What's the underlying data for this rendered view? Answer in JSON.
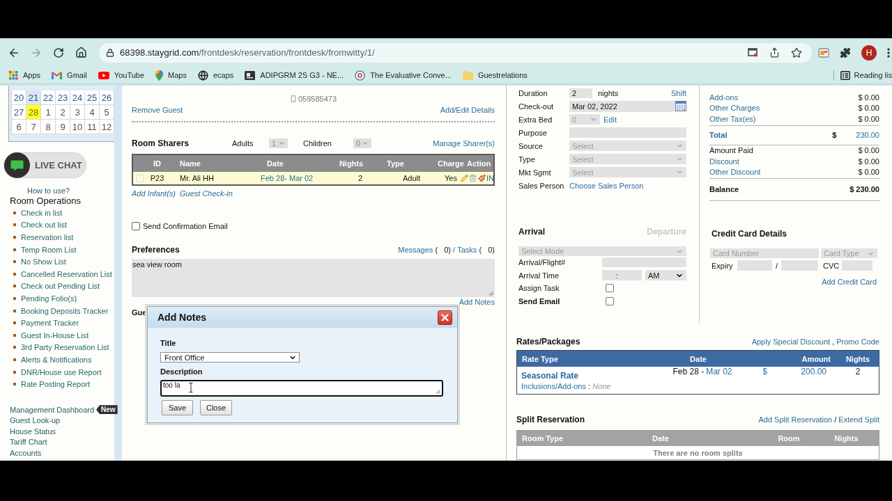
{
  "browser": {
    "url": {
      "domain": "68398.staygrid.com",
      "path": "/frontdesk/reservation/frontdesk/fromwitty/1/"
    },
    "profile_initial": "H",
    "bookmarks": [
      {
        "kind": "apps",
        "label": "Apps"
      },
      {
        "kind": "gmail",
        "label": "Gmail"
      },
      {
        "kind": "youtube",
        "label": "YouTube"
      },
      {
        "kind": "maps",
        "label": "Maps"
      },
      {
        "kind": "globe",
        "label": "ecaps"
      },
      {
        "kind": "card",
        "label": "ADIPGRM 2S G3 - NE..."
      },
      {
        "kind": "ring",
        "label": "The Evaluative Conve..."
      },
      {
        "kind": "folder",
        "label": "Guestrelations"
      }
    ],
    "reading_list": "Reading lis"
  },
  "sidebar": {
    "calendar": {
      "weeks": [
        [
          {
            "day": "20",
            "kind": "current",
            "selected": false,
            "hovered": false
          },
          {
            "day": "21",
            "kind": "current",
            "selected": false,
            "hovered": true
          },
          {
            "day": "22",
            "kind": "current",
            "selected": false,
            "hovered": false
          },
          {
            "day": "23",
            "kind": "current",
            "selected": false,
            "hovered": false
          },
          {
            "day": "24",
            "kind": "current",
            "selected": false,
            "hovered": false
          },
          {
            "day": "25",
            "kind": "current",
            "selected": false,
            "hovered": false
          },
          {
            "day": "26",
            "kind": "current",
            "selected": false,
            "hovered": false
          }
        ],
        [
          {
            "day": "27",
            "kind": "current",
            "selected": false,
            "hovered": false
          },
          {
            "day": "28",
            "kind": "current",
            "selected": true,
            "hovered": false
          },
          {
            "day": "1",
            "kind": "next",
            "selected": false,
            "hovered": false
          },
          {
            "day": "2",
            "kind": "next",
            "selected": false,
            "hovered": false
          },
          {
            "day": "3",
            "kind": "next",
            "selected": false,
            "hovered": false
          },
          {
            "day": "4",
            "kind": "next",
            "selected": false,
            "hovered": false
          },
          {
            "day": "5",
            "kind": "next",
            "selected": false,
            "hovered": false
          }
        ],
        [
          {
            "day": "6",
            "kind": "next",
            "selected": false,
            "hovered": false
          },
          {
            "day": "7",
            "kind": "next",
            "selected": false,
            "hovered": false
          },
          {
            "day": "8",
            "kind": "next",
            "selected": false,
            "hovered": false
          },
          {
            "day": "9",
            "kind": "next",
            "selected": false,
            "hovered": false
          },
          {
            "day": "10",
            "kind": "next",
            "selected": false,
            "hovered": false
          },
          {
            "day": "11",
            "kind": "next",
            "selected": false,
            "hovered": false
          },
          {
            "day": "12",
            "kind": "next",
            "selected": false,
            "hovered": false
          }
        ]
      ]
    },
    "live_chat": "LIVE CHAT",
    "help_link": "How to use?",
    "operations": {
      "title": "Room Operations",
      "items": [
        "Check in list",
        "Check out list",
        "Reservation list",
        "Temp Room List",
        "No Show List",
        "Cancelled Reservation List",
        "Check out Pending List",
        "Pending Folio(s)",
        "Booking Deposits Tracker",
        "Payment Tracker",
        "Guest In-House List",
        "3rd Party Reservation List",
        "Alerts & Notifications",
        "DNR/House use Report",
        "Rate Posting Report"
      ]
    },
    "links": [
      {
        "label": "Management Dashboard",
        "badge": "New"
      },
      {
        "label": "Guest Look-up"
      },
      {
        "label": "House Status"
      },
      {
        "label": "Tariff Chart"
      },
      {
        "label": "Accounts"
      }
    ]
  },
  "guest": {
    "phone": "059585473",
    "links": [
      "Remove Guest",
      "Add/Edit Details"
    ]
  },
  "room_sharers": {
    "title": "Room Sharers",
    "adults": {
      "label": "Adults",
      "value": "1",
      "disabled": true
    },
    "children": {
      "label": "Children",
      "value": "0",
      "disabled": true
    },
    "manage_link": "Manage Sharer(s)",
    "columns": [
      "ID",
      "Name",
      "Date",
      "Nights",
      "Type",
      "Charge",
      "Action"
    ],
    "rows": [
      {
        "checked": false,
        "id": "P23",
        "name": "Mr. Ali HH",
        "date": "Feb 28- Mar 02",
        "nights": "2",
        "type": "Adult",
        "charge": "Yes",
        "status": "IN"
      }
    ],
    "links": [
      "Add Infant(s)",
      "Guest Check-in"
    ]
  },
  "confirmation_email": {
    "label": "Send Confirmation Email",
    "checked": false
  },
  "preferences": {
    "title": "Preferences",
    "counters": [
      {
        "label": "Messages",
        "count": "(   0)"
      },
      {
        "label": "Tasks",
        "count": "(   0)"
      }
    ],
    "separator": "/",
    "value": "sea view room",
    "add_notes": "Add Notes"
  },
  "guest_notes": {
    "title": "Gue"
  },
  "dialog": {
    "title": "Add Notes",
    "fields": [
      {
        "kind": "select",
        "label": "Title",
        "value": "Front Office"
      },
      {
        "kind": "textarea",
        "label": "Description",
        "value": "too la",
        "focused": true
      }
    ],
    "buttons": [
      "Save",
      "Close"
    ]
  },
  "stay": {
    "fields": [
      {
        "kind": "duration",
        "label": "Duration",
        "value": "2",
        "suffix": "nights",
        "link": "Shift"
      },
      {
        "kind": "date",
        "label": "Check-out",
        "value": "Mar 02, 2022"
      },
      {
        "kind": "select-link",
        "label": "Extra Bed",
        "value": "0",
        "disabled": true,
        "link": "Edit"
      },
      {
        "kind": "input",
        "label": "Purpose"
      },
      {
        "kind": "select",
        "label": "Source",
        "placeholder": "Select"
      },
      {
        "kind": "select",
        "label": "Type",
        "placeholder": "Select"
      },
      {
        "kind": "select",
        "label": "Mkt Sgmt",
        "placeholder": "Select"
      },
      {
        "kind": "link",
        "label": "Sales Person",
        "link": "Choose Sales Person"
      }
    ]
  },
  "travel": {
    "tabs": [
      {
        "label": "Arrival",
        "selected": true
      },
      {
        "label": "Departure",
        "selected": false
      }
    ],
    "mode": {
      "placeholder": "Select Mode"
    },
    "fields": [
      {
        "kind": "input",
        "label": "Arrival/Flight#"
      },
      {
        "kind": "time",
        "label": "Arrival Time",
        "separator": ":",
        "period": "AM"
      },
      {
        "kind": "checkbox",
        "label": "Assign Task",
        "checked": false,
        "emphasis": false
      },
      {
        "kind": "checkbox",
        "label": "Send Email",
        "checked": false,
        "emphasis": true
      }
    ]
  },
  "billing": {
    "charges": [
      {
        "label": "Add-ons",
        "amount": "$ 0.00",
        "link": true
      },
      {
        "label": "Other Charges",
        "amount": "$ 0.00",
        "link": true
      },
      {
        "label": "Other Tax(es)",
        "amount": "$ 0.00",
        "link": true
      }
    ],
    "total": {
      "label": "Total",
      "currency": "$",
      "amount": "230.00"
    },
    "payments": [
      {
        "label": "Amount Paid",
        "amount": "$ 0.00",
        "link": false
      },
      {
        "label": "Discount",
        "amount": "$ 0.00",
        "link": true
      },
      {
        "label": "Other Discount",
        "amount": "$ 0.00",
        "link": true
      }
    ],
    "balance": {
      "label": "Balance",
      "amount": "$ 230.00"
    }
  },
  "credit_card": {
    "title": "Credit Card Details",
    "number": {
      "placeholder": "Card Number"
    },
    "type": {
      "placeholder": "Card Type"
    },
    "expiry_label": "Expiry",
    "expiry_separator": "/",
    "cvc_label": "CVC",
    "add_link": "Add Credit Card"
  },
  "rates": {
    "title": "Rates/Packages",
    "links": [
      "Apply Special Discount",
      "Promo Code"
    ],
    "separator": ",",
    "columns": [
      "Rate Type",
      "Date",
      "Amount",
      "Nights"
    ],
    "rows": [
      {
        "rate": "Seasonal Rate",
        "inclusions_label": "Inclusions/Add-ons",
        "inclusions_separator": ":",
        "inclusions": "None",
        "date_start": "Feb 28 -",
        "date_end": "Mar 02",
        "currency": "$",
        "amount": "200.00",
        "nights": "2"
      }
    ]
  },
  "split": {
    "title": "Split Reservation",
    "links": [
      "Add Split Reservation",
      "Extend Split"
    ],
    "separator": "/",
    "columns": [
      "Room Type",
      "Date",
      "Room",
      "Nights"
    ],
    "empty": "There are no room splits"
  }
}
